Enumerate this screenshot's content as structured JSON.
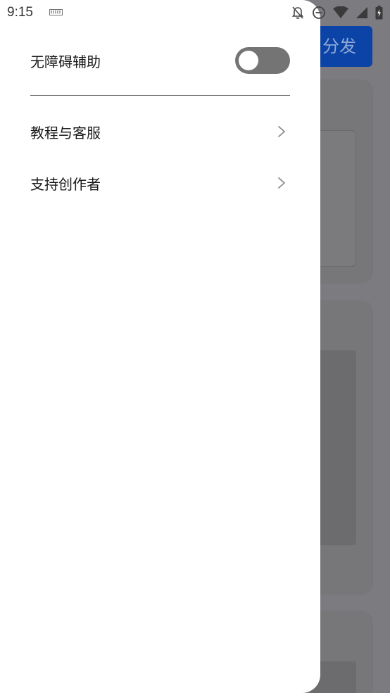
{
  "status_bar": {
    "time": "9:15",
    "icons": [
      "keyboard-icon",
      "notifications-off-icon",
      "do-not-disturb-icon",
      "wifi-icon",
      "signal-icon",
      "battery-charging-icon"
    ]
  },
  "background_app": {
    "primary_button_label": "分发"
  },
  "drawer": {
    "accessibility": {
      "label": "无障碍辅助",
      "toggle_on": false
    },
    "items": [
      {
        "label": "教程与客服",
        "icon": "chevron-right-icon"
      },
      {
        "label": "支持创作者",
        "icon": "chevron-right-icon"
      }
    ]
  },
  "colors": {
    "drawer_bg": "#ffffff",
    "scrim": "#7b7b80",
    "toggle_off": "#747474",
    "accent_blue": "#0b44a6"
  }
}
